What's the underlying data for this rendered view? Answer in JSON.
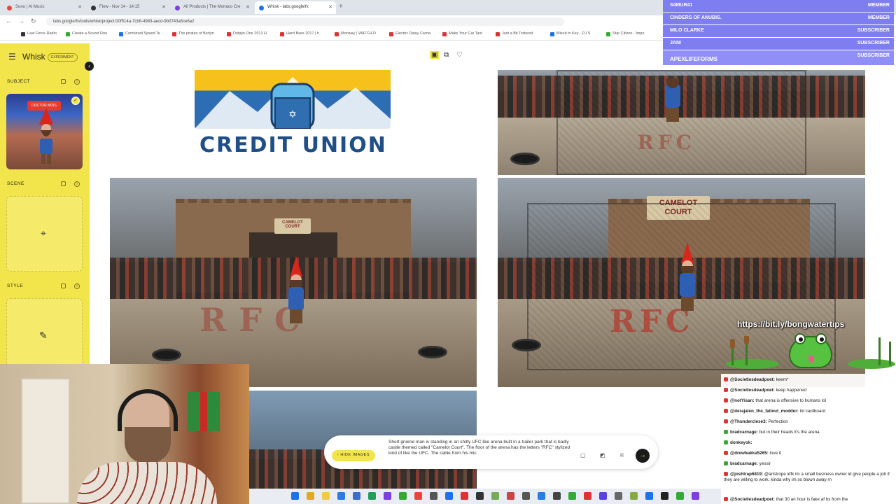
{
  "browser": {
    "tabs": [
      {
        "label": "Suno | AI Music",
        "color": "#e5483b",
        "active": false
      },
      {
        "label": "Flow - Nov 14 - 14:15",
        "color": "#333333",
        "active": false
      },
      {
        "label": "All Products | The Monaco Cre",
        "color": "#7b3fe4",
        "active": false
      },
      {
        "label": "Whisk - labs.google/fx",
        "color": "#1a73e8",
        "active": true
      }
    ],
    "url": "labs.google/fx/tools/whisk/project/10f514a-7cb8-4983-aecd-9b0743a5ce6a2",
    "bookmarks": [
      "Last Force Radio",
      "Create a Sound Roo",
      "Combined Speed Te",
      "The pirates of Berlyn",
      "Dolpjin One 2013 H",
      "Hard Bass 2017 | h",
      "Moriway | WATCH D",
      "Electric Daisy Carniv",
      "Make Your Car Tast",
      "Just a Bit Tortured",
      "Mixed in Key - DJ S",
      "Star Citizen - Impo"
    ]
  },
  "app": {
    "name": "Whisk",
    "badge": "EXPERIMENT",
    "sections": {
      "subject": "SUBJECT",
      "scene": "SCENE",
      "style": "STYLE"
    },
    "subject_banner": "DOCTOR MOIS"
  },
  "gallery": {
    "logo_text": "CREDIT UNION",
    "sign_small": "CAMELOT COURT",
    "sign_large": "CAMELOT COURT",
    "floor_letters": "RFC"
  },
  "prompt": {
    "hide_label": "HIDE IMAGES",
    "text": "Short gnome man is standing in an shitty UFC like arena built in a trailer park that is badly castle themed called \"Camelot Court\". The floor of the arena has the letters \"RFC\" stylized kind of like the UFC. The cable from his mic"
  },
  "alerts": [
    {
      "name": "S4MUR41",
      "tier": "MEMBER"
    },
    {
      "name": "CINDERS OF ANUBIS.",
      "tier": "MEMBER"
    },
    {
      "name": "MILO CLARKE",
      "tier": "SUBSCRIBER"
    },
    {
      "name": "JANI",
      "tier": "SUBSCRIBER"
    },
    {
      "name": "APEXLIFEFORMS",
      "tier": "SUBSCRIBER"
    }
  ],
  "overlay": {
    "link": "https://bit.ly/bongwatertips"
  },
  "chat": [
    {
      "user": "@Societiesdeadpoet:",
      "msg": "keem*",
      "badge": "#d33"
    },
    {
      "user": "@Societiesdeadpoet:",
      "msg": "keep happened",
      "badge": "#d33"
    },
    {
      "user": "@notYisan:",
      "msg": "that arena is offensive to humans lol",
      "badge": "#d33"
    },
    {
      "user": "@derajalen_the_fallout_modder:",
      "msg": "lol cardboard",
      "badge": "#d33"
    },
    {
      "user": "@Thunderclese3:",
      "msg": "Perfection",
      "badge": "#d33"
    },
    {
      "user": "bradcarnage:",
      "msg": "but in their heads it's the arena",
      "badge": "#3a3"
    },
    {
      "user": "donkeyok:",
      "msg": "",
      "badge": "#3a3"
    },
    {
      "user": "@drewbakka5265:",
      "msg": "love it",
      "badge": "#d33"
    },
    {
      "user": "bradcarnage:",
      "msg": "yessir",
      "badge": "#3a3"
    },
    {
      "user": "@joshtrap6819:",
      "msg": "@arlstrope idfk im a small business owner id give people a job if they are willing to work. kinda why im so blown away rn",
      "badge": "#d33"
    },
    {
      "user": "@Societiesdeadpoet:",
      "msg": "that 30 an hour is fake af bs from the",
      "badge": "#d33"
    }
  ]
}
